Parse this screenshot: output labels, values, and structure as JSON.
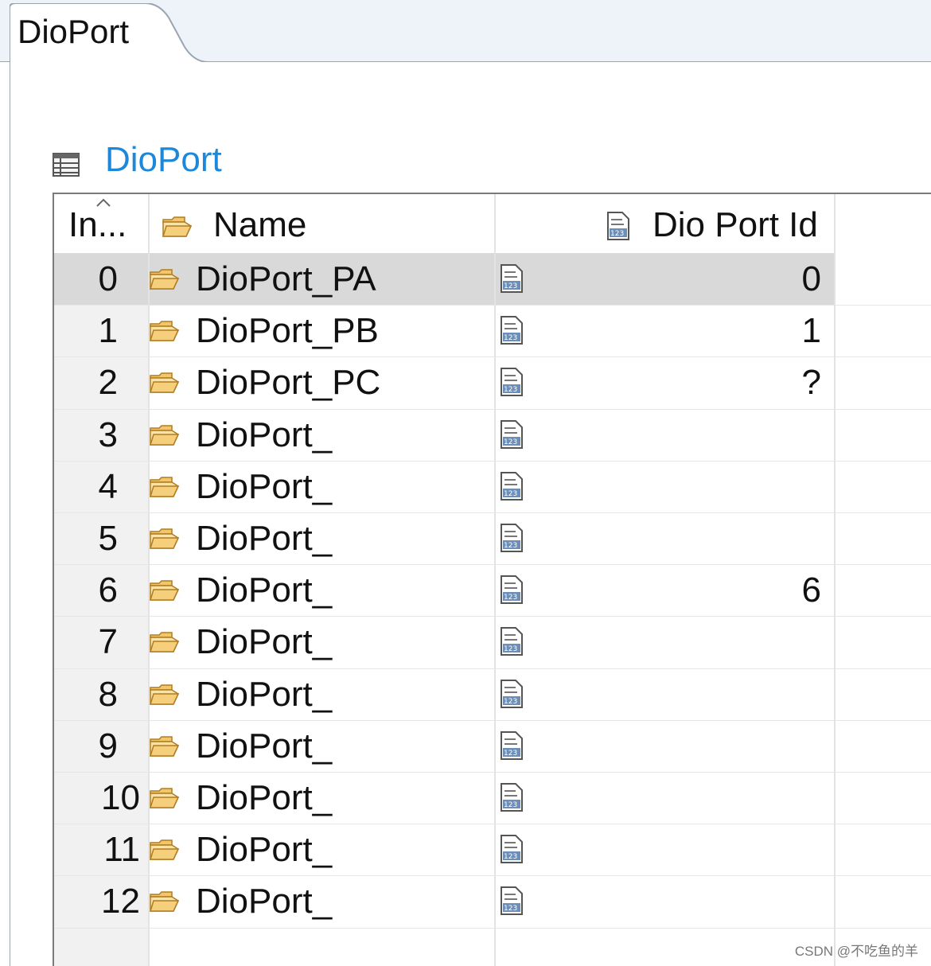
{
  "editor_tab": {
    "label": "DioPort"
  },
  "section": {
    "title": "DioPort",
    "icon": "table-icon"
  },
  "table": {
    "columns": {
      "index": "In...",
      "name": "Name",
      "id": "Dio Port Id"
    },
    "rows": [
      {
        "index": "0",
        "name": "DioPort_PA",
        "value": "0"
      },
      {
        "index": "1",
        "name": "DioPort_PB",
        "value": "1"
      },
      {
        "index": "2",
        "name": "DioPort_PC",
        "value": "?"
      },
      {
        "index": "3",
        "name": "DioPort_",
        "value": ""
      },
      {
        "index": "4",
        "name": "DioPort_",
        "value": ""
      },
      {
        "index": "5",
        "name": "DioPort_",
        "value": ""
      },
      {
        "index": "6",
        "name": "DioPort_",
        "value": "6"
      },
      {
        "index": "7",
        "name": "DioPort_",
        "value": ""
      },
      {
        "index": "8",
        "name": "DioPort_",
        "value": ""
      },
      {
        "index": "9",
        "name": "DioPort_",
        "value": ""
      },
      {
        "index": "10",
        "name": "DioPort_",
        "value": ""
      },
      {
        "index": "11",
        "name": "DioPort_",
        "value": ""
      },
      {
        "index": "12",
        "name": "DioPort_",
        "value": ""
      }
    ],
    "selected_row": "0"
  },
  "watermark": "CSDN @不吃鱼的羊",
  "colors": {
    "accent": "#1e88d8",
    "selection": "#d9d9d9",
    "folder": "#e8b04a"
  }
}
